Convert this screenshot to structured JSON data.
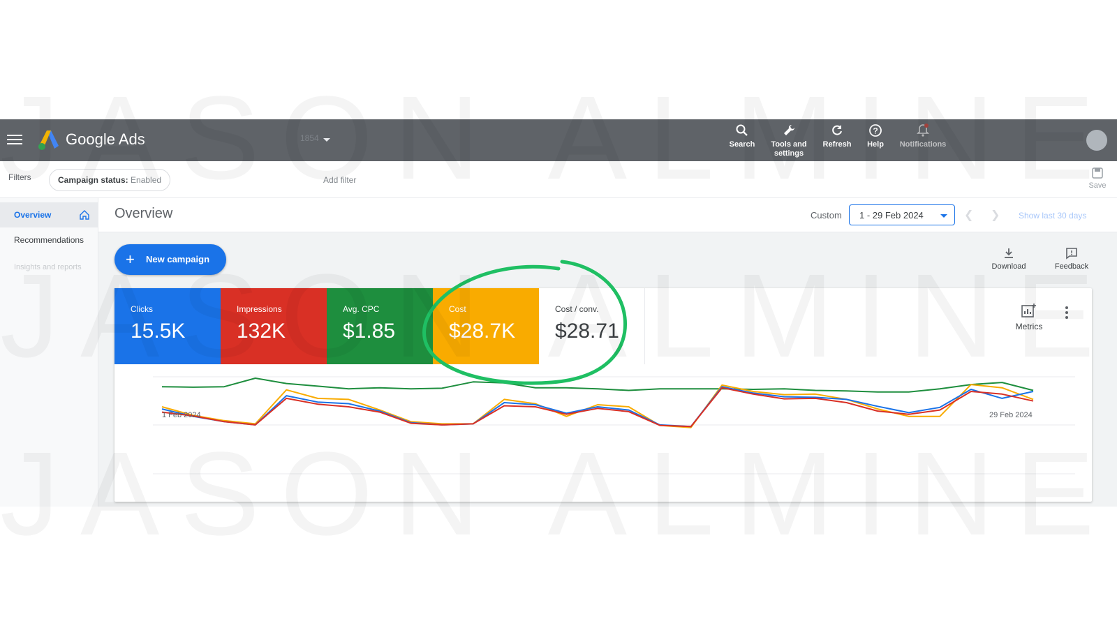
{
  "topbar": {
    "brand": "Google Ads",
    "account_fragment": "1854",
    "buttons": [
      {
        "label_line1": "Search",
        "label_line2": ""
      },
      {
        "label_line1": "Tools and",
        "label_line2": "settings"
      },
      {
        "label_line1": "Refresh",
        "label_line2": ""
      },
      {
        "label_line1": "Help",
        "label_line2": ""
      },
      {
        "label_line1": "Notifications",
        "label_line2": ""
      }
    ]
  },
  "filters": {
    "label": "Filters",
    "chip_key": "Campaign status:",
    "chip_value": "Enabled",
    "add_filter": "Add filter",
    "save_label": "Save"
  },
  "sidebar": {
    "items": [
      {
        "label": "Overview",
        "active": true
      },
      {
        "label": "Recommendations",
        "active": false
      },
      {
        "label": "Insights and reports",
        "active": false
      }
    ]
  },
  "overview": {
    "title": "Overview",
    "range_type": "Custom",
    "date_range": "1 - 29 Feb 2024",
    "show_last": "Show last 30 days",
    "new_campaign": "New campaign",
    "download": "Download",
    "feedback": "Feedback",
    "metrics_label": "Metrics"
  },
  "tiles": [
    {
      "name": "Clicks",
      "value": "15.5K",
      "color": "#1a73e8"
    },
    {
      "name": "Impressions",
      "value": "132K",
      "color": "#d93025"
    },
    {
      "name": "Avg. CPC",
      "value": "$1.85",
      "color": "#1e8e3e"
    },
    {
      "name": "Cost",
      "value": "$28.7K",
      "color": "#f9ab00"
    },
    {
      "name": "Cost / conv.",
      "value": "$28.71",
      "color": "#ffffff"
    }
  ],
  "highlight_color": "#1fbf63",
  "watermark_text": "JASON ALMINE",
  "chart_data": {
    "type": "line",
    "x_start_label": "1 Feb 2024",
    "x_end_label": "29 Feb 2024",
    "x": [
      1,
      2,
      3,
      4,
      5,
      6,
      7,
      8,
      9,
      10,
      11,
      12,
      13,
      14,
      15,
      16,
      17,
      18,
      19,
      20,
      21,
      22,
      23,
      24,
      25,
      26,
      27,
      28,
      29
    ],
    "grid": true,
    "series": [
      {
        "color": "#1e8e3e",
        "values": [
          84,
          83,
          84,
          100,
          90,
          85,
          80,
          82,
          80,
          81,
          93,
          91,
          82,
          82,
          80,
          77,
          80,
          80,
          80,
          79,
          80,
          77,
          76,
          74,
          74,
          80,
          88,
          92,
          77
        ]
      },
      {
        "color": "#f9ab00",
        "values": [
          46,
          30,
          20,
          14,
          78,
          62,
          60,
          40,
          18,
          14,
          14,
          60,
          52,
          28,
          50,
          46,
          11,
          7,
          87,
          75,
          69,
          70,
          60,
          42,
          28,
          28,
          88,
          82,
          60
        ]
      },
      {
        "color": "#1a73e8",
        "values": [
          42,
          28,
          18,
          12,
          67,
          55,
          52,
          38,
          16,
          12,
          14,
          54,
          50,
          34,
          46,
          40,
          12,
          9,
          84,
          72,
          65,
          64,
          60,
          47,
          35,
          45,
          79,
          62,
          75
        ]
      },
      {
        "color": "#d93025",
        "values": [
          36,
          29,
          18,
          12,
          62,
          51,
          46,
          36,
          15,
          12,
          14,
          48,
          46,
          32,
          43,
          37,
          11,
          9,
          82,
          70,
          61,
          62,
          54,
          38,
          32,
          40,
          75,
          70,
          57
        ]
      }
    ]
  }
}
